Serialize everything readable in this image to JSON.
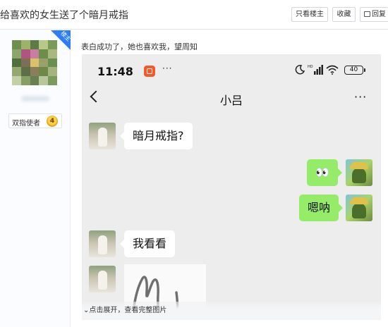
{
  "header": {
    "title": "给喜欢的女生送了个暗月戒指",
    "only_owner_label": "只看楼主",
    "favorite_label": "收藏",
    "reply_label": "回复"
  },
  "author": {
    "owner_tag": "楼主",
    "badge_text": "双指使者",
    "level": "4"
  },
  "post": {
    "text": "表白成功了，她也喜欢我，望周知",
    "expand_label": "点击展开，查看完整图片"
  },
  "screenshot": {
    "status_time": "11:48",
    "status_more": "···",
    "battery": "40",
    "chat_title": "小吕",
    "more": "···",
    "messages": [
      {
        "side": "left",
        "text": "暗月戒指?"
      },
      {
        "side": "right",
        "text": "👀"
      },
      {
        "side": "right",
        "text": "嗯呐"
      },
      {
        "side": "left",
        "text": "我看看"
      }
    ]
  },
  "colors": {
    "accent_blue": "#2d7df6",
    "chat_bg": "#ededed",
    "bubble_green": "#95ec69"
  }
}
